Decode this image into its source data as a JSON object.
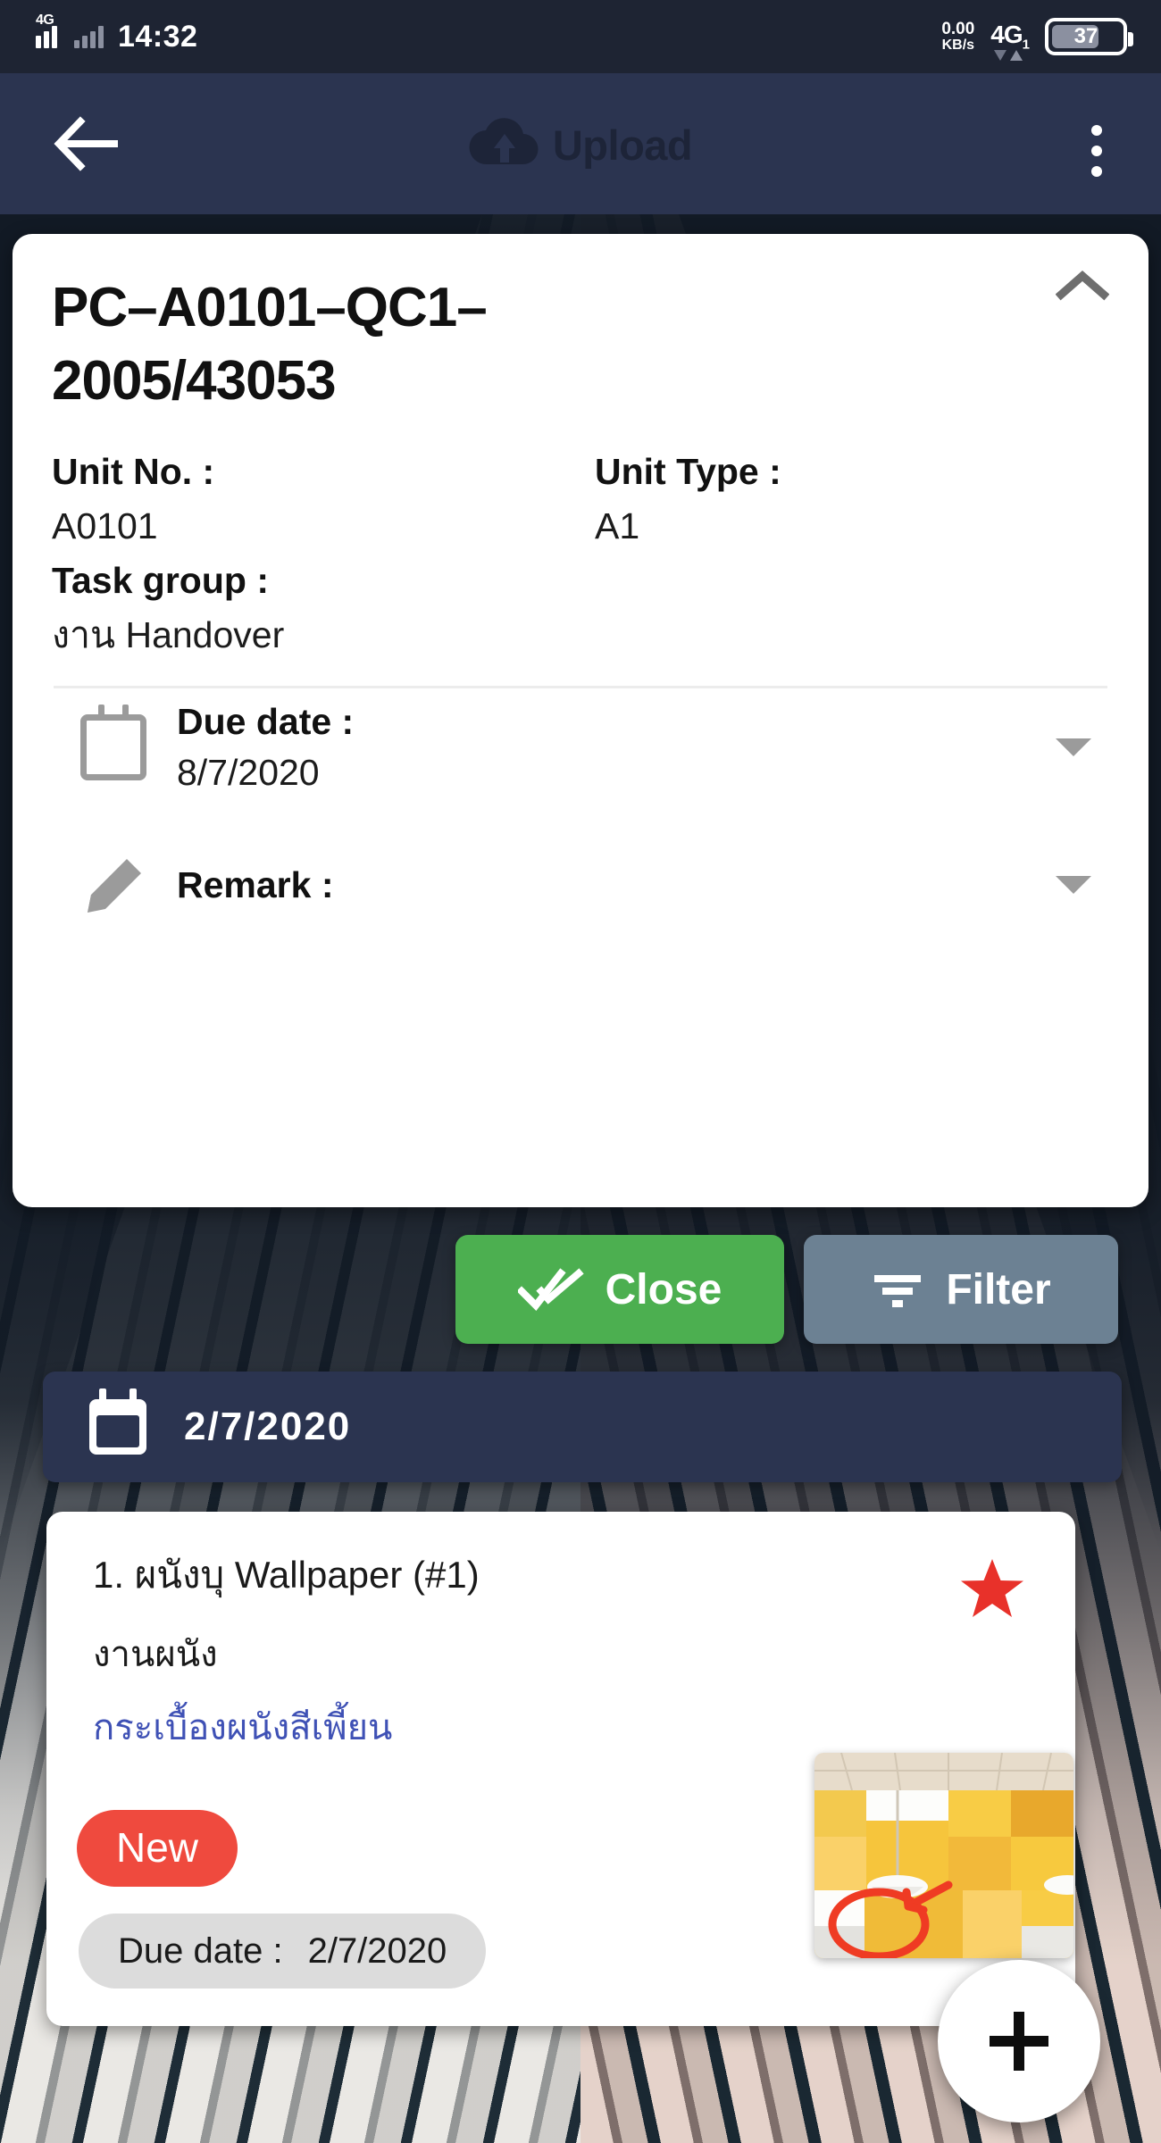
{
  "statusbar": {
    "network_generation": "4G",
    "clock": "14:32",
    "net_speed_value": "0.00",
    "net_speed_unit": "KB/s",
    "sim_label": "4G",
    "sim_index": "1",
    "battery_percent": "37",
    "icons": {
      "signal": "signal-bars-icon",
      "signal_secondary": "signal-bars-secondary-icon",
      "battery": "battery-icon",
      "traffic_arrows": "data-traffic-arrows-icon"
    }
  },
  "appbar": {
    "back_icon": "back-arrow-icon",
    "title": "Upload",
    "title_icon": "cloud-upload-icon",
    "overflow_icon": "overflow-menu-icon",
    "background_color": "#2b3450"
  },
  "detail_card": {
    "title": "PC–A0101–QC1–2005/43053",
    "collapse_icon": "chevron-up-icon",
    "fields": [
      {
        "label": "Unit No. :",
        "value": "A0101"
      },
      {
        "label": "Unit Type :",
        "value": "A1"
      },
      {
        "label": "Task group :",
        "value": "งาน Handover"
      }
    ],
    "rows": [
      {
        "icon": "calendar-icon",
        "label": "Due date :",
        "value": "8/7/2020",
        "caret": "caret-down-icon"
      },
      {
        "icon": "pencil-icon",
        "label": "Remark :",
        "value": "",
        "caret": "caret-down-icon"
      }
    ]
  },
  "actions": {
    "close": {
      "label": "Close",
      "icon": "double-check-icon",
      "color": "#4caf50"
    },
    "filter": {
      "label": "Filter",
      "icon": "filter-icon",
      "color": "#6c8193"
    }
  },
  "date_header": {
    "icon": "calendar-icon",
    "date": "2/7/2020"
  },
  "task": {
    "title": "1. ผนังบุ Wallpaper (#1)",
    "subtitle": "งานผนัง",
    "issue": "กระเบื้องผนังสีเพี้ยน",
    "star_icon": "star-icon",
    "star_color": "#e8312a",
    "badge": "New",
    "badge_color": "#ef4a3e",
    "due_label": "Due date :",
    "due_value": "2/7/2020",
    "thumbnail_alt": "wall-photo-thumbnail"
  },
  "fab": {
    "icon": "plus-icon",
    "label": "+"
  }
}
